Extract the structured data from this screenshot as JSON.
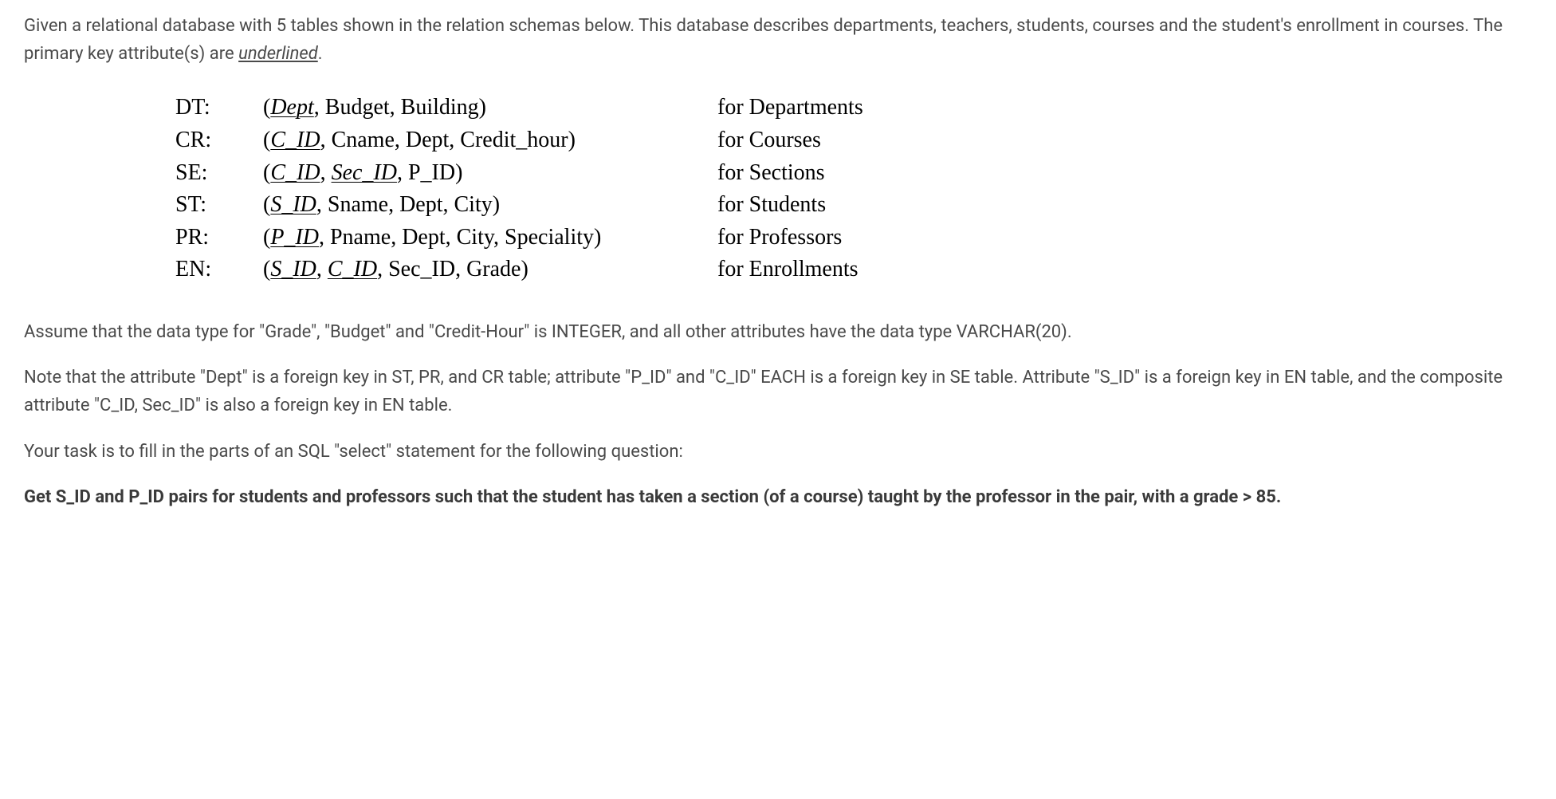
{
  "intro": {
    "text_before_underline": "Given  a relational database with 5 tables shown in the relation schemas below.   This database describes departments, teachers,  students, courses and the student's enrollment in courses. The primary key  attribute(s) are ",
    "underlined_word": "underlined",
    "text_after_underline": "."
  },
  "schemas": {
    "dt": {
      "label": "DT:",
      "open_paren": "(",
      "pk1": "Dept",
      "rest": ", Budget, Building)",
      "desc": "for Departments"
    },
    "cr": {
      "label": "CR:",
      "open_paren": "(",
      "pk1": "C_ID",
      "rest": ", Cname,  Dept, Credit_hour)",
      "desc": "for Courses"
    },
    "se": {
      "label": "SE:",
      "open_paren": "(",
      "pk1": "C_ID",
      "comma1": ", ",
      "pk2": "Sec_ID",
      "rest": ", P_ID)",
      "desc": "for Sections"
    },
    "st": {
      "label": "ST:",
      "open_paren": "(",
      "pk1": "S_ID",
      "rest": ", Sname, Dept, City)",
      "desc": "for Students"
    },
    "pr": {
      "label": "PR:",
      "open_paren": "(",
      "pk1": "P_ID",
      "rest": ", Pname, Dept, City, Speciality)",
      "desc": "for Professors"
    },
    "en": {
      "label": "EN:",
      "open_paren": "(",
      "pk1": "S_ID",
      "comma1": ", ",
      "pk2": "C_ID",
      "rest": ", Sec_ID, Grade)",
      "desc": "for Enrollments"
    }
  },
  "paragraphs": {
    "datatypes": " Assume that the data type for \"Grade\", \"Budget\" and \"Credit-Hour\" is INTEGER, and all other attributes have the data type VARCHAR(20).",
    "foreignkeys": "Note that the attribute \"Dept\" is a foreign key in ST, PR, and CR table;   attribute \"P_ID\" and \"C_ID\" EACH is a foreign key in SE table.  Attribute \"S_ID\" is a foreign key in EN table, and the composite attribute \"C_ID, Sec_ID\" is also a foreign key in EN table.",
    "task": "Your task is to fill in the parts of an SQL \"select\" statement for the following question:",
    "question": "Get S_ID and P_ID pairs for students and professors  such that the student  has taken a section (of a course) taught by the professor in the pair,  with a grade > 85."
  }
}
